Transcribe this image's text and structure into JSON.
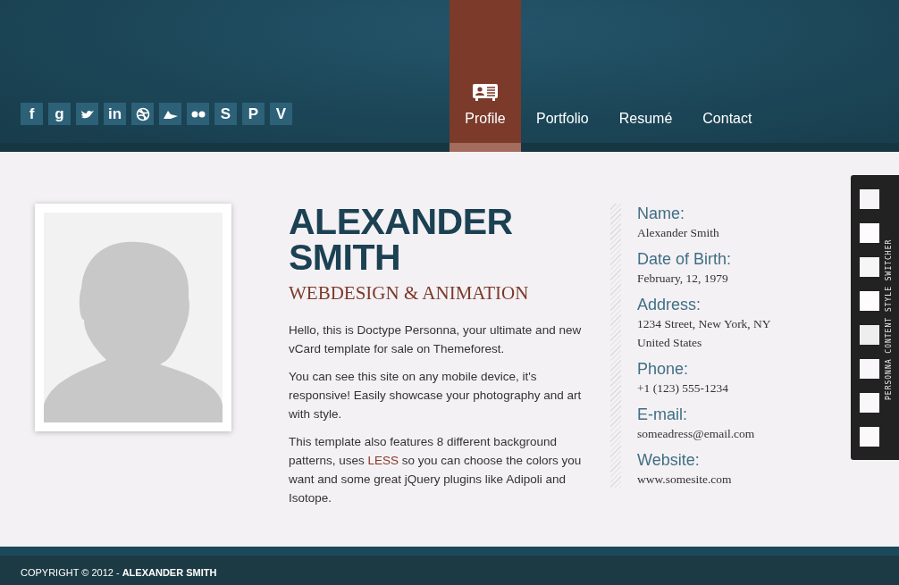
{
  "social": [
    {
      "kind": "letter",
      "glyph": "f"
    },
    {
      "kind": "letter",
      "glyph": "g"
    },
    {
      "kind": "bird"
    },
    {
      "kind": "letter",
      "glyph": "in"
    },
    {
      "kind": "ball"
    },
    {
      "kind": "shape"
    },
    {
      "kind": "dots"
    },
    {
      "kind": "letter",
      "glyph": "S"
    },
    {
      "kind": "letter",
      "glyph": "P"
    },
    {
      "kind": "letter",
      "glyph": "V"
    }
  ],
  "nav": [
    {
      "label": "Profile",
      "selected": true
    },
    {
      "label": "Portfolio",
      "selected": false
    },
    {
      "label": "Resumé",
      "selected": false
    },
    {
      "label": "Contact",
      "selected": false
    }
  ],
  "profile": {
    "name_line1": "ALEXANDER",
    "name_line2": "SMITH",
    "subtitle": "WEBDESIGN & ANIMATION",
    "paragraphs": [
      "Hello, this is Doctype Personna, your ultimate and new vCard template for sale on Themeforest.",
      "You can see this site on any mobile device, it's responsive! Easily showcase your photography and art with style.",
      "This template also features 8 different background patterns, uses **LESS** so you can choose the colors you want and some great jQuery plugins like Adipoli and Isotope."
    ]
  },
  "details": [
    {
      "label": "Name:",
      "lines": [
        "Alexander Smith"
      ]
    },
    {
      "label": "Date of Birth:",
      "lines": [
        "February, 12, 1979"
      ]
    },
    {
      "label": "Address:",
      "lines": [
        "1234 Street, New York, NY",
        "United States"
      ]
    },
    {
      "label": "Phone:",
      "lines": [
        "+1 (123) 555-1234"
      ]
    },
    {
      "label": "E-mail:",
      "lines": [
        "someadress@email.com"
      ]
    },
    {
      "label": "Website:",
      "lines": [
        "www.somesite.com"
      ]
    }
  ],
  "style_switcher": {
    "title": "PERSONNA CONTENT STYLE SWITCHER",
    "swatches": [
      {
        "color": "#f6f4f7"
      },
      {
        "color": "#fdfbfd"
      },
      {
        "color": "#f7f6f6"
      },
      {
        "color": "#fefcfd"
      },
      {
        "color": "#efeeef"
      },
      {
        "color": "#f8f6f8"
      },
      {
        "color": "#f9f7f9"
      },
      {
        "color": "#fcf9fa"
      }
    ]
  },
  "footer": {
    "copyright": "COPYRIGHT © 2012 - **ALEXANDER SMITH**"
  }
}
